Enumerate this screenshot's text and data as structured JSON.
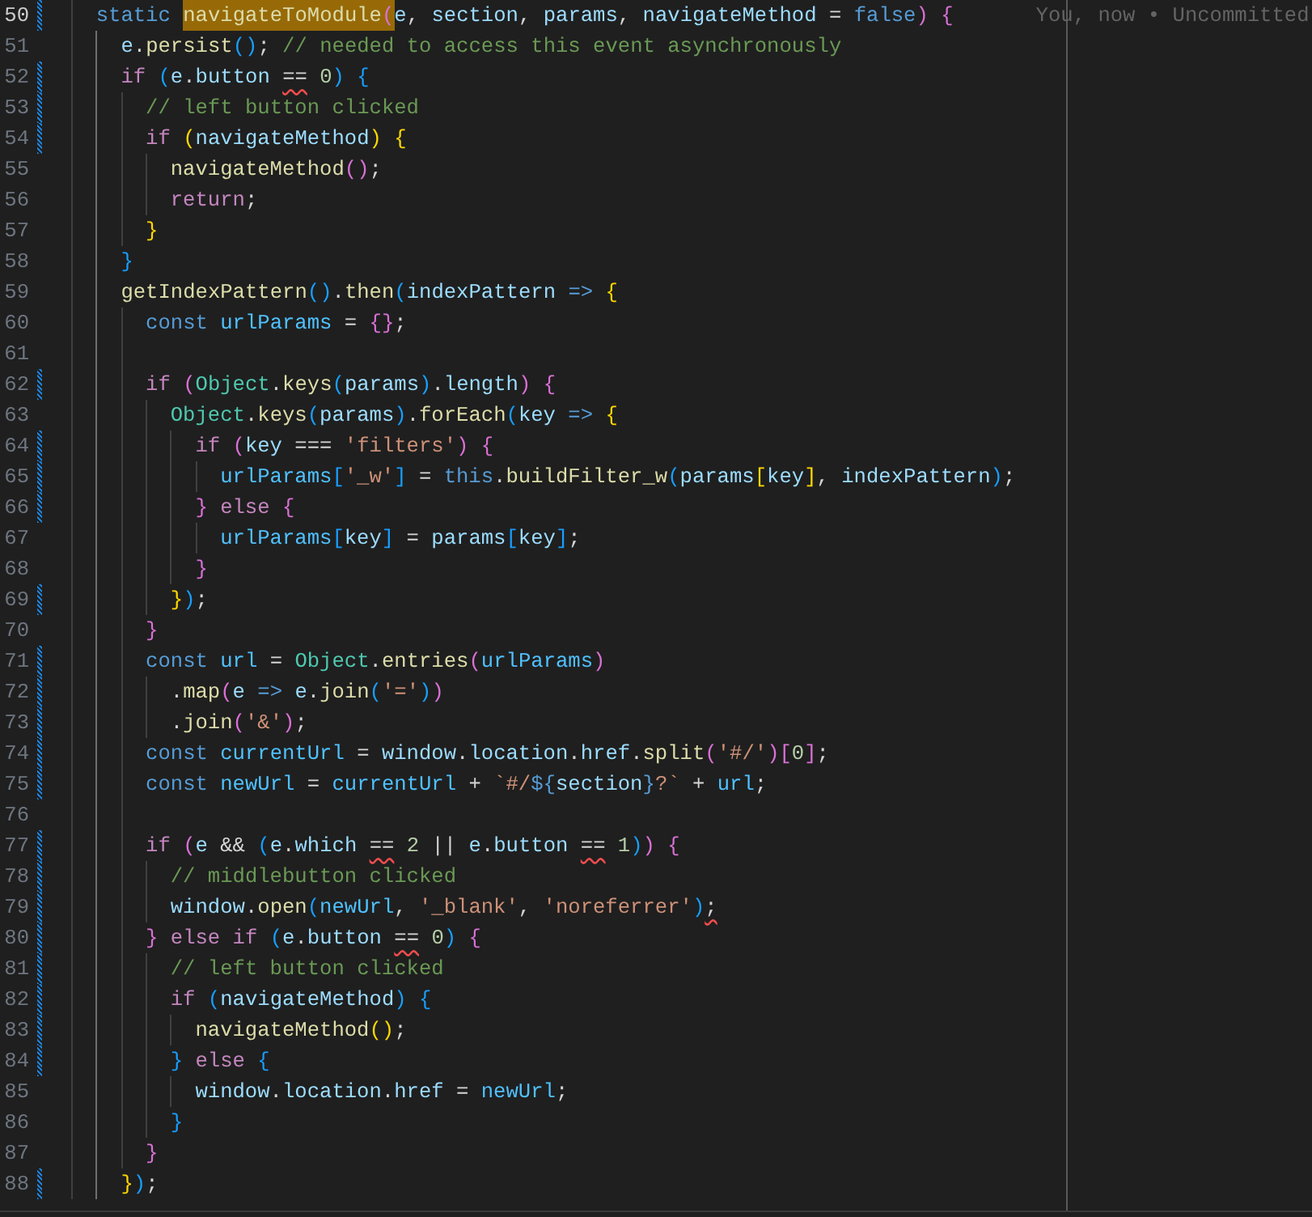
{
  "lines": [
    {
      "number": "50",
      "current": true,
      "changed": true,
      "tokens": [
        {
          "kind": "storage",
          "text": "static "
        },
        {
          "kind": "match",
          "tokens": [
            {
              "kind": "function",
              "text": "navigateToModule"
            },
            {
              "kind": "bracket2",
              "text": "("
            }
          ]
        },
        {
          "kind": "variable",
          "text": "e"
        },
        {
          "kind": "punctuation",
          "text": ", "
        },
        {
          "kind": "variable",
          "text": "section"
        },
        {
          "kind": "punctuation",
          "text": ", "
        },
        {
          "kind": "variable",
          "text": "params"
        },
        {
          "kind": "punctuation",
          "text": ", "
        },
        {
          "kind": "variable",
          "text": "navigateMethod"
        },
        {
          "kind": "punctuation",
          "text": " = "
        },
        {
          "kind": "storage",
          "text": "false"
        },
        {
          "kind": "bracket2",
          "text": ") {"
        }
      ],
      "annotation": "You, now • Uncommitted",
      "children": [
        {
          "number": "51",
          "current": false,
          "changed": false,
          "tokens": [
            {
              "kind": "variable",
              "text": "e"
            },
            {
              "kind": "punctuation",
              "text": "."
            },
            {
              "kind": "function",
              "text": "persist"
            },
            {
              "kind": "bracket3",
              "text": "()"
            },
            {
              "kind": "punctuation",
              "text": "; "
            },
            {
              "kind": "comment",
              "text": "// needed to access this event asynchronously"
            }
          ]
        },
        {
          "number": "52",
          "current": false,
          "changed": true,
          "tokens": [
            {
              "kind": "control",
              "text": "if "
            },
            {
              "kind": "bracket3",
              "text": "("
            },
            {
              "kind": "variable",
              "text": "e"
            },
            {
              "kind": "punctuation",
              "text": "."
            },
            {
              "kind": "variable",
              "text": "button "
            },
            {
              "kind": "flagged",
              "text": "=="
            },
            {
              "kind": "number",
              "text": " 0"
            },
            {
              "kind": "bracket3",
              "text": ") {"
            }
          ],
          "children": [
            {
              "number": "53",
              "current": false,
              "changed": true,
              "tokens": [
                {
                  "kind": "comment",
                  "text": "// left button clicked"
                }
              ]
            },
            {
              "number": "54",
              "current": false,
              "changed": true,
              "tokens": [
                {
                  "kind": "control",
                  "text": "if "
                },
                {
                  "kind": "bracket1",
                  "text": "("
                },
                {
                  "kind": "variable",
                  "text": "navigateMethod"
                },
                {
                  "kind": "bracket1",
                  "text": ") {"
                }
              ],
              "children": [
                {
                  "number": "55",
                  "current": false,
                  "changed": false,
                  "tokens": [
                    {
                      "kind": "function",
                      "text": "navigateMethod"
                    },
                    {
                      "kind": "bracket2",
                      "text": "()"
                    },
                    {
                      "kind": "punctuation",
                      "text": ";"
                    }
                  ]
                },
                {
                  "number": "56",
                  "current": false,
                  "changed": false,
                  "tokens": [
                    {
                      "kind": "control",
                      "text": "return"
                    },
                    {
                      "kind": "punctuation",
                      "text": ";"
                    }
                  ]
                }
              ]
            },
            {
              "number": "57",
              "current": false,
              "changed": false,
              "tokens": [
                {
                  "kind": "bracket1",
                  "text": "}"
                }
              ]
            }
          ]
        },
        {
          "number": "58",
          "current": false,
          "changed": false,
          "tokens": [
            {
              "kind": "bracket3",
              "text": "}"
            }
          ]
        },
        {
          "number": "59",
          "current": false,
          "changed": false,
          "tokens": [
            {
              "kind": "function",
              "text": "getIndexPattern"
            },
            {
              "kind": "bracket3",
              "text": "()"
            },
            {
              "kind": "punctuation",
              "text": "."
            },
            {
              "kind": "function",
              "text": "then"
            },
            {
              "kind": "bracket3",
              "text": "("
            },
            {
              "kind": "variable",
              "text": "indexPattern "
            },
            {
              "kind": "storage",
              "text": "=> "
            },
            {
              "kind": "bracket1",
              "text": "{"
            }
          ],
          "children": [
            {
              "number": "60",
              "current": false,
              "changed": false,
              "tokens": [
                {
                  "kind": "storage",
                  "text": "const "
                },
                {
                  "kind": "constant",
                  "text": "urlParams"
                },
                {
                  "kind": "punctuation",
                  "text": " = "
                },
                {
                  "kind": "bracket2",
                  "text": "{}"
                },
                {
                  "kind": "punctuation",
                  "text": ";"
                }
              ]
            },
            {
              "number": "61",
              "current": false,
              "changed": false
            },
            {
              "number": "62",
              "current": false,
              "changed": true,
              "tokens": [
                {
                  "kind": "control",
                  "text": "if "
                },
                {
                  "kind": "bracket2",
                  "text": "("
                },
                {
                  "kind": "class",
                  "text": "Object"
                },
                {
                  "kind": "punctuation",
                  "text": "."
                },
                {
                  "kind": "function",
                  "text": "keys"
                },
                {
                  "kind": "bracket3",
                  "text": "("
                },
                {
                  "kind": "variable",
                  "text": "params"
                },
                {
                  "kind": "bracket3",
                  "text": ")"
                },
                {
                  "kind": "punctuation",
                  "text": "."
                },
                {
                  "kind": "variable",
                  "text": "length"
                },
                {
                  "kind": "bracket2",
                  "text": ") {"
                }
              ],
              "children": [
                {
                  "number": "63",
                  "current": false,
                  "changed": false,
                  "tokens": [
                    {
                      "kind": "class",
                      "text": "Object"
                    },
                    {
                      "kind": "punctuation",
                      "text": "."
                    },
                    {
                      "kind": "function",
                      "text": "keys"
                    },
                    {
                      "kind": "bracket3",
                      "text": "("
                    },
                    {
                      "kind": "variable",
                      "text": "params"
                    },
                    {
                      "kind": "bracket3",
                      "text": ")"
                    },
                    {
                      "kind": "punctuation",
                      "text": "."
                    },
                    {
                      "kind": "function",
                      "text": "forEach"
                    },
                    {
                      "kind": "bracket3",
                      "text": "("
                    },
                    {
                      "kind": "variable",
                      "text": "key "
                    },
                    {
                      "kind": "storage",
                      "text": "=> "
                    },
                    {
                      "kind": "bracket1",
                      "text": "{"
                    }
                  ],
                  "children": [
                    {
                      "number": "64",
                      "current": false,
                      "changed": true,
                      "tokens": [
                        {
                          "kind": "control",
                          "text": "if "
                        },
                        {
                          "kind": "bracket2",
                          "text": "("
                        },
                        {
                          "kind": "variable",
                          "text": "key"
                        },
                        {
                          "kind": "punctuation",
                          "text": " === "
                        },
                        {
                          "kind": "string",
                          "text": "'filters'"
                        },
                        {
                          "kind": "bracket2",
                          "text": ") {"
                        }
                      ],
                      "children": [
                        {
                          "number": "65",
                          "current": false,
                          "changed": true,
                          "tokens": [
                            {
                              "kind": "constant",
                              "text": "urlParams"
                            },
                            {
                              "kind": "bracket3",
                              "text": "["
                            },
                            {
                              "kind": "string",
                              "text": "'_w'"
                            },
                            {
                              "kind": "bracket3",
                              "text": "]"
                            },
                            {
                              "kind": "punctuation",
                              "text": " = "
                            },
                            {
                              "kind": "storage",
                              "text": "this"
                            },
                            {
                              "kind": "punctuation",
                              "text": "."
                            },
                            {
                              "kind": "function",
                              "text": "buildFilter_w"
                            },
                            {
                              "kind": "bracket3",
                              "text": "("
                            },
                            {
                              "kind": "variable",
                              "text": "params"
                            },
                            {
                              "kind": "bracket1",
                              "text": "["
                            },
                            {
                              "kind": "variable",
                              "text": "key"
                            },
                            {
                              "kind": "bracket1",
                              "text": "]"
                            },
                            {
                              "kind": "punctuation",
                              "text": ", "
                            },
                            {
                              "kind": "variable",
                              "text": "indexPattern"
                            },
                            {
                              "kind": "bracket3",
                              "text": ")"
                            },
                            {
                              "kind": "punctuation",
                              "text": ";"
                            }
                          ]
                        }
                      ]
                    },
                    {
                      "number": "66",
                      "current": false,
                      "changed": true,
                      "tokens": [
                        {
                          "kind": "bracket2",
                          "text": "} "
                        },
                        {
                          "kind": "control",
                          "text": "else "
                        },
                        {
                          "kind": "bracket2",
                          "text": "{"
                        }
                      ],
                      "children": [
                        {
                          "number": "67",
                          "current": false,
                          "changed": false,
                          "tokens": [
                            {
                              "kind": "constant",
                              "text": "urlParams"
                            },
                            {
                              "kind": "bracket3",
                              "text": "["
                            },
                            {
                              "kind": "variable",
                              "text": "key"
                            },
                            {
                              "kind": "bracket3",
                              "text": "]"
                            },
                            {
                              "kind": "punctuation",
                              "text": " = "
                            },
                            {
                              "kind": "variable",
                              "text": "params"
                            },
                            {
                              "kind": "bracket3",
                              "text": "["
                            },
                            {
                              "kind": "variable",
                              "text": "key"
                            },
                            {
                              "kind": "bracket3",
                              "text": "]"
                            },
                            {
                              "kind": "punctuation",
                              "text": ";"
                            }
                          ]
                        }
                      ]
                    },
                    {
                      "number": "68",
                      "current": false,
                      "changed": false,
                      "tokens": [
                        {
                          "kind": "bracket2",
                          "text": "}"
                        }
                      ]
                    }
                  ]
                },
                {
                  "number": "69",
                  "current": false,
                  "changed": true,
                  "tokens": [
                    {
                      "kind": "bracket1",
                      "text": "}"
                    },
                    {
                      "kind": "bracket3",
                      "text": ")"
                    },
                    {
                      "kind": "punctuation",
                      "text": ";"
                    }
                  ]
                }
              ]
            },
            {
              "number": "70",
              "current": false,
              "changed": false,
              "tokens": [
                {
                  "kind": "bracket2",
                  "text": "}"
                }
              ]
            },
            {
              "number": "71",
              "current": false,
              "changed": true,
              "tokens": [
                {
                  "kind": "storage",
                  "text": "const "
                },
                {
                  "kind": "constant",
                  "text": "url"
                },
                {
                  "kind": "punctuation",
                  "text": " = "
                },
                {
                  "kind": "class",
                  "text": "Object"
                },
                {
                  "kind": "punctuation",
                  "text": "."
                },
                {
                  "kind": "function",
                  "text": "entries"
                },
                {
                  "kind": "bracket2",
                  "text": "("
                },
                {
                  "kind": "constant",
                  "text": "urlParams"
                },
                {
                  "kind": "bracket2",
                  "text": ")"
                }
              ],
              "children": [
                {
                  "number": "72",
                  "current": false,
                  "changed": true,
                  "tokens": [
                    {
                      "kind": "punctuation",
                      "text": "."
                    },
                    {
                      "kind": "function",
                      "text": "map"
                    },
                    {
                      "kind": "bracket2",
                      "text": "("
                    },
                    {
                      "kind": "variable",
                      "text": "e "
                    },
                    {
                      "kind": "storage",
                      "text": "=> "
                    },
                    {
                      "kind": "variable",
                      "text": "e"
                    },
                    {
                      "kind": "punctuation",
                      "text": "."
                    },
                    {
                      "kind": "function",
                      "text": "join"
                    },
                    {
                      "kind": "bracket3",
                      "text": "("
                    },
                    {
                      "kind": "string",
                      "text": "'='"
                    },
                    {
                      "kind": "bracket3",
                      "text": ")"
                    },
                    {
                      "kind": "bracket2",
                      "text": ")"
                    }
                  ]
                },
                {
                  "number": "73",
                  "current": false,
                  "changed": true,
                  "tokens": [
                    {
                      "kind": "punctuation",
                      "text": "."
                    },
                    {
                      "kind": "function",
                      "text": "join"
                    },
                    {
                      "kind": "bracket2",
                      "text": "("
                    },
                    {
                      "kind": "string",
                      "text": "'&'"
                    },
                    {
                      "kind": "bracket2",
                      "text": ")"
                    },
                    {
                      "kind": "punctuation",
                      "text": ";"
                    }
                  ]
                }
              ]
            },
            {
              "number": "74",
              "current": false,
              "changed": true,
              "tokens": [
                {
                  "kind": "storage",
                  "text": "const "
                },
                {
                  "kind": "constant",
                  "text": "currentUrl"
                },
                {
                  "kind": "punctuation",
                  "text": " = "
                },
                {
                  "kind": "variable",
                  "text": "window"
                },
                {
                  "kind": "punctuation",
                  "text": "."
                },
                {
                  "kind": "variable",
                  "text": "location"
                },
                {
                  "kind": "punctuation",
                  "text": "."
                },
                {
                  "kind": "variable",
                  "text": "href"
                },
                {
                  "kind": "punctuation",
                  "text": "."
                },
                {
                  "kind": "function",
                  "text": "split"
                },
                {
                  "kind": "bracket2",
                  "text": "("
                },
                {
                  "kind": "string",
                  "text": "'#/'"
                },
                {
                  "kind": "bracket2",
                  "text": ")["
                },
                {
                  "kind": "number",
                  "text": "0"
                },
                {
                  "kind": "bracket2",
                  "text": "]"
                },
                {
                  "kind": "punctuation",
                  "text": ";"
                }
              ]
            },
            {
              "number": "75",
              "current": false,
              "changed": true,
              "tokens": [
                {
                  "kind": "storage",
                  "text": "const "
                },
                {
                  "kind": "constant",
                  "text": "newUrl"
                },
                {
                  "kind": "punctuation",
                  "text": " = "
                },
                {
                  "kind": "constant",
                  "text": "currentUrl"
                },
                {
                  "kind": "punctuation",
                  "text": " + "
                },
                {
                  "kind": "string",
                  "text": "`#/"
                },
                {
                  "kind": "storage",
                  "text": "${"
                },
                {
                  "kind": "variable",
                  "text": "section"
                },
                {
                  "kind": "storage",
                  "text": "}"
                },
                {
                  "kind": "string",
                  "text": "?`"
                },
                {
                  "kind": "punctuation",
                  "text": " + "
                },
                {
                  "kind": "constant",
                  "text": "url"
                },
                {
                  "kind": "punctuation",
                  "text": ";"
                }
              ]
            },
            {
              "number": "76",
              "current": false,
              "changed": false
            },
            {
              "number": "77",
              "current": false,
              "changed": true,
              "tokens": [
                {
                  "kind": "control",
                  "text": "if "
                },
                {
                  "kind": "bracket2",
                  "text": "("
                },
                {
                  "kind": "variable",
                  "text": "e"
                },
                {
                  "kind": "punctuation",
                  "text": " && "
                },
                {
                  "kind": "bracket3",
                  "text": "("
                },
                {
                  "kind": "variable",
                  "text": "e"
                },
                {
                  "kind": "punctuation",
                  "text": "."
                },
                {
                  "kind": "variable",
                  "text": "which "
                },
                {
                  "kind": "flagged",
                  "text": "=="
                },
                {
                  "kind": "number",
                  "text": " 2"
                },
                {
                  "kind": "punctuation",
                  "text": " || "
                },
                {
                  "kind": "variable",
                  "text": "e"
                },
                {
                  "kind": "punctuation",
                  "text": "."
                },
                {
                  "kind": "variable",
                  "text": "button "
                },
                {
                  "kind": "flagged",
                  "text": "=="
                },
                {
                  "kind": "number",
                  "text": " 1"
                },
                {
                  "kind": "bracket3",
                  "text": ")"
                },
                {
                  "kind": "bracket2",
                  "text": ") {"
                }
              ],
              "children": [
                {
                  "number": "78",
                  "current": false,
                  "changed": true,
                  "tokens": [
                    {
                      "kind": "comment",
                      "text": "// middlebutton clicked"
                    }
                  ]
                },
                {
                  "number": "79",
                  "current": false,
                  "changed": true,
                  "tokens": [
                    {
                      "kind": "variable",
                      "text": "window"
                    },
                    {
                      "kind": "punctuation",
                      "text": "."
                    },
                    {
                      "kind": "function",
                      "text": "open"
                    },
                    {
                      "kind": "bracket3",
                      "text": "("
                    },
                    {
                      "kind": "constant",
                      "text": "newUrl"
                    },
                    {
                      "kind": "punctuation",
                      "text": ", "
                    },
                    {
                      "kind": "string",
                      "text": "'_blank'"
                    },
                    {
                      "kind": "punctuation",
                      "text": ", "
                    },
                    {
                      "kind": "string",
                      "text": "'noreferrer'"
                    },
                    {
                      "kind": "bracket3",
                      "text": ")"
                    },
                    {
                      "kind": "flagged",
                      "text": ";"
                    }
                  ]
                }
              ]
            },
            {
              "number": "80",
              "current": false,
              "changed": true,
              "tokens": [
                {
                  "kind": "bracket2",
                  "text": "} "
                },
                {
                  "kind": "control",
                  "text": "else if "
                },
                {
                  "kind": "bracket3",
                  "text": "("
                },
                {
                  "kind": "variable",
                  "text": "e"
                },
                {
                  "kind": "punctuation",
                  "text": "."
                },
                {
                  "kind": "variable",
                  "text": "button "
                },
                {
                  "kind": "flagged",
                  "text": "=="
                },
                {
                  "kind": "number",
                  "text": " 0"
                },
                {
                  "kind": "bracket3",
                  "text": ") "
                },
                {
                  "kind": "bracket2",
                  "text": "{"
                }
              ],
              "children": [
                {
                  "number": "81",
                  "current": false,
                  "changed": true,
                  "tokens": [
                    {
                      "kind": "comment",
                      "text": "// left button clicked"
                    }
                  ]
                },
                {
                  "number": "82",
                  "current": false,
                  "changed": true,
                  "tokens": [
                    {
                      "kind": "control",
                      "text": "if "
                    },
                    {
                      "kind": "bracket3",
                      "text": "("
                    },
                    {
                      "kind": "variable",
                      "text": "navigateMethod"
                    },
                    {
                      "kind": "bracket3",
                      "text": ") {"
                    }
                  ],
                  "children": [
                    {
                      "number": "83",
                      "current": false,
                      "changed": true,
                      "tokens": [
                        {
                          "kind": "function",
                          "text": "navigateMethod"
                        },
                        {
                          "kind": "bracket1",
                          "text": "()"
                        },
                        {
                          "kind": "punctuation",
                          "text": ";"
                        }
                      ]
                    }
                  ]
                },
                {
                  "number": "84",
                  "current": false,
                  "changed": true,
                  "tokens": [
                    {
                      "kind": "bracket3",
                      "text": "} "
                    },
                    {
                      "kind": "control",
                      "text": "else "
                    },
                    {
                      "kind": "bracket3",
                      "text": "{"
                    }
                  ],
                  "children": [
                    {
                      "number": "85",
                      "current": false,
                      "changed": false,
                      "tokens": [
                        {
                          "kind": "variable",
                          "text": "window"
                        },
                        {
                          "kind": "punctuation",
                          "text": "."
                        },
                        {
                          "kind": "variable",
                          "text": "location"
                        },
                        {
                          "kind": "punctuation",
                          "text": "."
                        },
                        {
                          "kind": "variable",
                          "text": "href"
                        },
                        {
                          "kind": "punctuation",
                          "text": " = "
                        },
                        {
                          "kind": "constant",
                          "text": "newUrl"
                        },
                        {
                          "kind": "punctuation",
                          "text": ";"
                        }
                      ]
                    }
                  ]
                },
                {
                  "number": "86",
                  "current": false,
                  "changed": false,
                  "tokens": [
                    {
                      "kind": "bracket3",
                      "text": "}"
                    }
                  ]
                }
              ]
            },
            {
              "number": "87",
              "current": false,
              "changed": false,
              "tokens": [
                {
                  "kind": "bracket2",
                  "text": "}"
                }
              ]
            }
          ]
        },
        {
          "number": "88",
          "current": false,
          "changed": true,
          "tokens": [
            {
              "kind": "bracket1",
              "text": "}"
            },
            {
              "kind": "bracket3",
              "text": ")"
            },
            {
              "kind": "punctuation",
              "text": ";"
            }
          ]
        }
      ]
    }
  ]
}
